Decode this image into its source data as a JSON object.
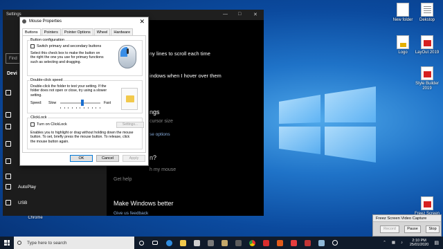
{
  "desktop": {
    "icons": [
      {
        "label": "New folder"
      },
      {
        "label": "Dekstop"
      },
      {
        "label": "Logo"
      },
      {
        "label": "LayOut 2019"
      },
      {
        "label": "Style Builder 2019"
      },
      {
        "label": "Freez Screen"
      }
    ],
    "below_window_label": "Chrome"
  },
  "settings_window": {
    "title": "Settings",
    "search_placeholder": "Find",
    "section_title": "Devi",
    "sidebar": [
      {
        "label": "AutoPlay",
        "icon": "autoplay-icon"
      },
      {
        "label": "USB",
        "icon": "usb-icon"
      }
    ],
    "content": {
      "scroll_text": "ny lines to scroll each time",
      "hover_text": "indows when I hover over them",
      "settings_heading": "ngs",
      "cursor_size": "cursor size",
      "mouse_options": "se options",
      "question_heading": "n?",
      "my_mouse": "h my mouse",
      "get_help": "Get help",
      "better_heading": "Make Windows better",
      "feedback": "Give us feedback"
    }
  },
  "mouse_properties": {
    "title": "Mouse Properties",
    "tabs": [
      "Buttons",
      "Pointers",
      "Pointer Options",
      "Wheel",
      "Hardware"
    ],
    "button_config": {
      "label": "Button configuration",
      "checkbox": "Switch primary and secondary buttons",
      "description": "Select this check box to make the button on the right the one you use for primary functions such as selecting and dragging."
    },
    "double_click": {
      "label": "Double-click speed",
      "description": "Double-click the folder to test your setting. If the folder does not open or close, try using a slower setting.",
      "speed_label": "Speed:",
      "slow": "Slow",
      "fast": "Fast",
      "speed_fraction": 0.55
    },
    "clicklock": {
      "label": "ClickLock",
      "checkbox": "Turn on ClickLock",
      "settings_button": "Settings...",
      "description": "Enables you to highlight or drag without holding down the mouse button. To set, briefly press the mouse button. To release, click the mouse button again."
    },
    "buttons": {
      "ok": "OK",
      "cancel": "Cancel",
      "apply": "Apply"
    }
  },
  "freez_screen": {
    "title": "Freez Screen Video Capture",
    "record": "Record",
    "pause": "Pause",
    "stop": "Stop"
  },
  "taskbar": {
    "search_placeholder": "Type here to search",
    "time": "2:10 PM",
    "date": "25/01/2020"
  }
}
